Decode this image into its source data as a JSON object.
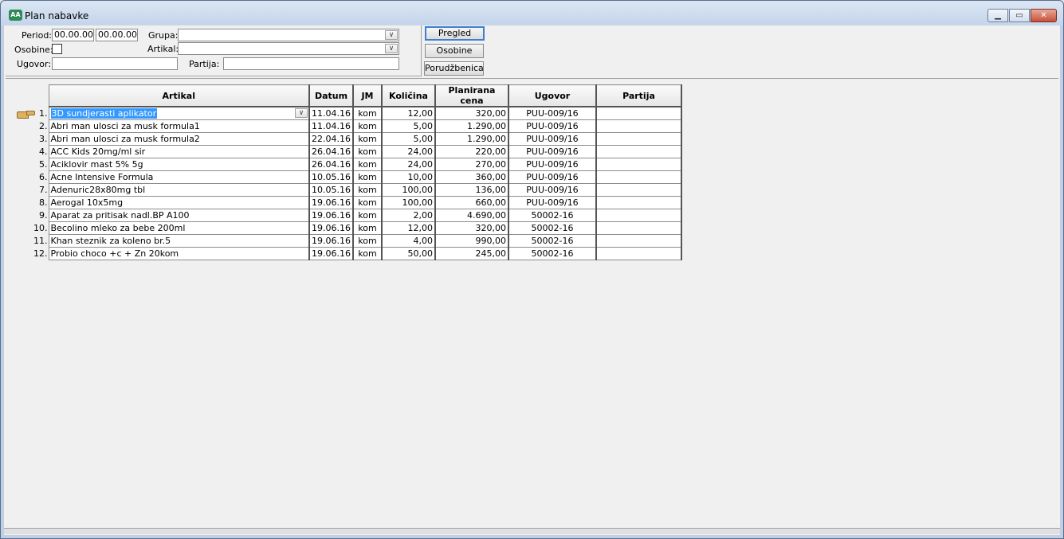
{
  "window": {
    "title": "Plan nabavke"
  },
  "filters": {
    "period_label": "Period:",
    "period_from": "00.00.00",
    "period_to": "00.00.00",
    "grupa_label": "Grupa:",
    "grupa_value": "",
    "osobine_label": "Osobine:",
    "artikal_label": "Artikal:",
    "artikal_value": "",
    "ugovor_label": "Ugovor:",
    "ugovor_value": "",
    "partija_label": "Partija:",
    "partija_value": ""
  },
  "buttons": {
    "pregled": "Pregled",
    "osobine": "Osobine",
    "porudzbenica": "Porudžbenica"
  },
  "grid": {
    "columns": [
      "Artikal",
      "Datum",
      "JM",
      "Količina",
      "Planirana cena",
      "Ugovor",
      "Partija"
    ],
    "rows": [
      {
        "n": "1.",
        "artikal": "3D sundjerasti aplikator",
        "datum": "11.04.16",
        "jm": "kom",
        "kolicina": "12,00",
        "cena": "320,00",
        "ugovor": "PUU-009/16",
        "partija": ""
      },
      {
        "n": "2.",
        "artikal": "Abri man ulosci za musk formula1",
        "datum": "11.04.16",
        "jm": "kom",
        "kolicina": "5,00",
        "cena": "1.290,00",
        "ugovor": "PUU-009/16",
        "partija": ""
      },
      {
        "n": "3.",
        "artikal": "Abri man ulosci za musk formula2",
        "datum": "22.04.16",
        "jm": "kom",
        "kolicina": "5,00",
        "cena": "1.290,00",
        "ugovor": "PUU-009/16",
        "partija": ""
      },
      {
        "n": "4.",
        "artikal": "ACC Kids 20mg/ml sir",
        "datum": "26.04.16",
        "jm": "kom",
        "kolicina": "24,00",
        "cena": "220,00",
        "ugovor": "PUU-009/16",
        "partija": ""
      },
      {
        "n": "5.",
        "artikal": "Aciklovir mast 5% 5g",
        "datum": "26.04.16",
        "jm": "kom",
        "kolicina": "24,00",
        "cena": "270,00",
        "ugovor": "PUU-009/16",
        "partija": ""
      },
      {
        "n": "6.",
        "artikal": "Acne Intensive Formula",
        "datum": "10.05.16",
        "jm": "kom",
        "kolicina": "10,00",
        "cena": "360,00",
        "ugovor": "PUU-009/16",
        "partija": ""
      },
      {
        "n": "7.",
        "artikal": "Adenuric28x80mg tbl",
        "datum": "10.05.16",
        "jm": "kom",
        "kolicina": "100,00",
        "cena": "136,00",
        "ugovor": "PUU-009/16",
        "partija": ""
      },
      {
        "n": "8.",
        "artikal": "Aerogal 10x5mg",
        "datum": "19.06.16",
        "jm": "kom",
        "kolicina": "100,00",
        "cena": "660,00",
        "ugovor": "PUU-009/16",
        "partija": ""
      },
      {
        "n": "9.",
        "artikal": "Aparat za pritisak nadl.BP A100",
        "datum": "19.06.16",
        "jm": "kom",
        "kolicina": "2,00",
        "cena": "4.690,00",
        "ugovor": "50002-16",
        "partija": ""
      },
      {
        "n": "10.",
        "artikal": "Becolino mleko za bebe 200ml",
        "datum": "19.06.16",
        "jm": "kom",
        "kolicina": "12,00",
        "cena": "320,00",
        "ugovor": "50002-16",
        "partija": ""
      },
      {
        "n": "11.",
        "artikal": "Khan steznik za koleno br.5",
        "datum": "19.06.16",
        "jm": "kom",
        "kolicina": "4,00",
        "cena": "990,00",
        "ugovor": "50002-16",
        "partija": ""
      },
      {
        "n": "12.",
        "artikal": "Probio choco +c + Zn 20kom",
        "datum": "19.06.16",
        "jm": "kom",
        "kolicina": "50,00",
        "cena": "245,00",
        "ugovor": "50002-16",
        "partija": ""
      }
    ]
  },
  "icons": {
    "app": "app-icon",
    "pointer": "hand-pointer-icon",
    "dropdown": "chevron-down-icon"
  }
}
